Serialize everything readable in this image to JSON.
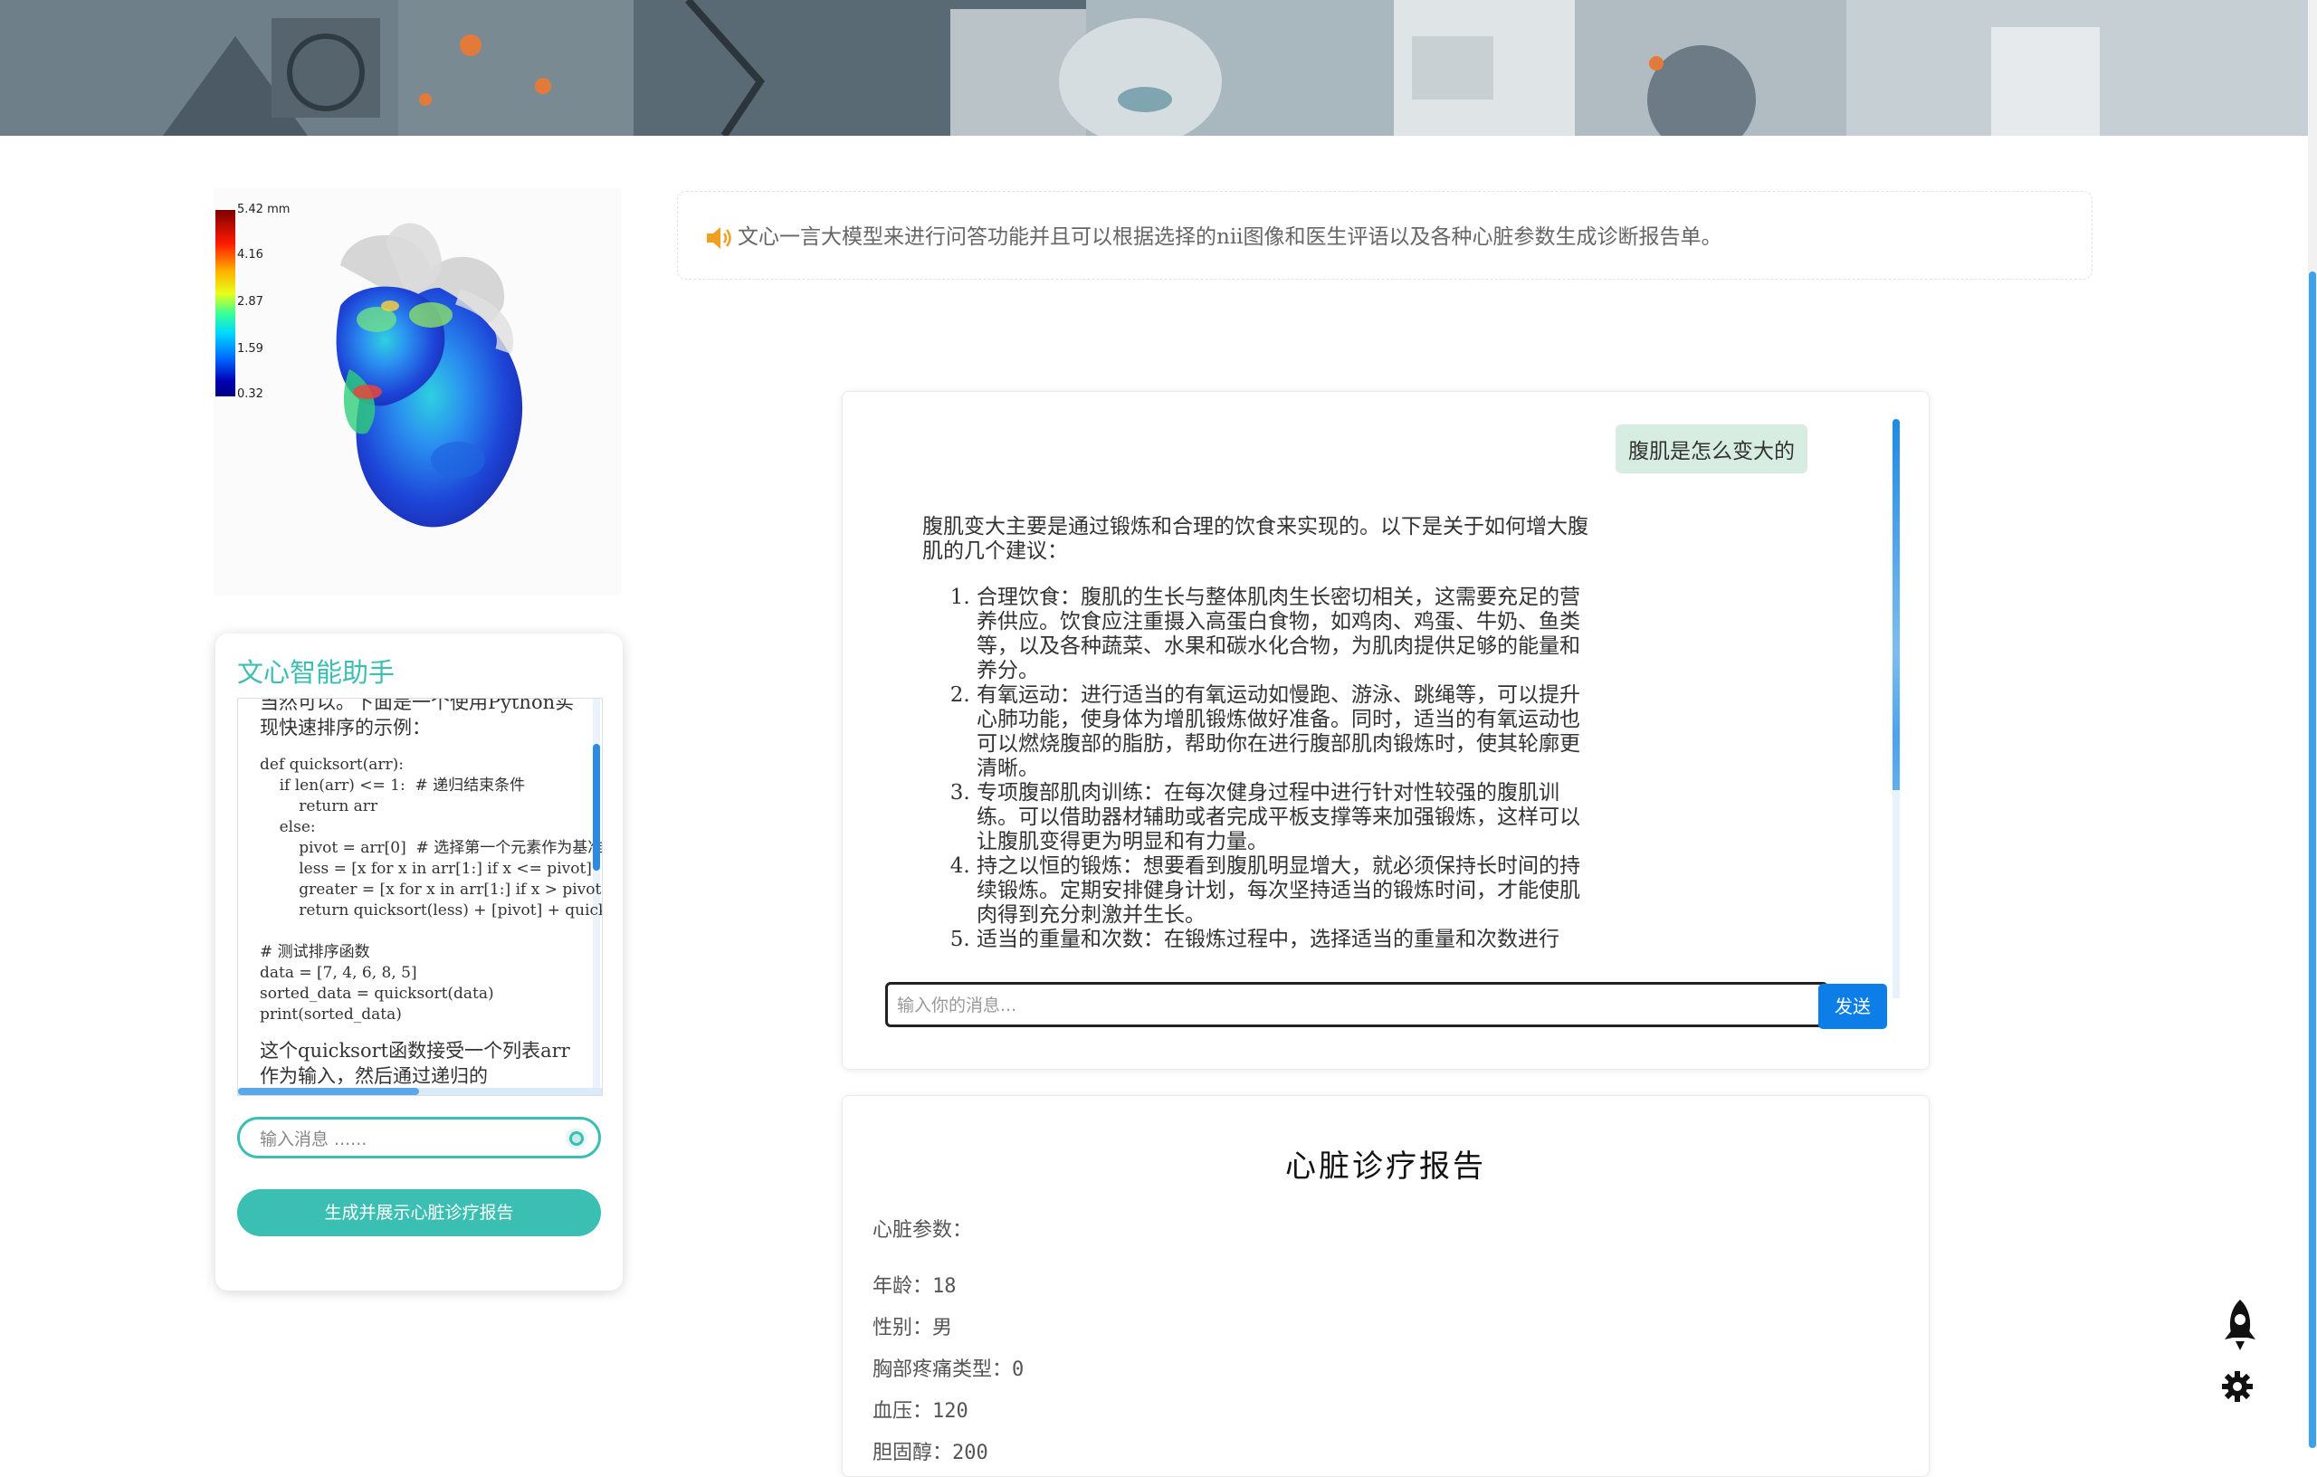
{
  "banner": {
    "alt": "anime illustration banner"
  },
  "heart_viewer": {
    "colorbar_labels": [
      "5.42 mm",
      "4.16",
      "2.87",
      "1.59",
      "0.32"
    ],
    "colors": [
      "#7f0000",
      "#ff1a00",
      "#ffb300",
      "#33ff99",
      "#0066ff",
      "#000080"
    ]
  },
  "assistant": {
    "title": "文心智能助手",
    "message_intro": "当然可以。下面是一个使用Python实现快速排序的示例：",
    "code": "def quicksort(arr):\n    if len(arr) <= 1:  # 递归结束条件\n        return arr\n    else:\n        pivot = arr[0]  # 选择第一个元素作为基准\n        less = [x for x in arr[1:] if x <= pivot]\n        greater = [x for x in arr[1:] if x > pivot]\n        return quicksort(less) + [pivot] + quicksort(greater)\n\n# 测试排序函数\ndata = [7, 4, 6, 8, 5]\nsorted_data = quicksort(data)\nprint(sorted_data)",
    "message_tail": "这个quicksort函数接受一个列表arr作为输入，然后通过递归的",
    "input_placeholder": "输入消息 ......",
    "report_button": "生成并展示心脏诊疗报告",
    "accent": "#3cbfb3"
  },
  "notice": {
    "text": "文心一言大模型来进行问答功能并且可以根据选择的nii图像和医生评语以及各种心脏参数生成诊断报告单。"
  },
  "chat": {
    "user_message": "腹肌是怎么变大的",
    "answer_intro": "腹肌变大主要是通过锻炼和合理的饮食来实现的。以下是关于如何增大腹肌的几个建议：",
    "answer_items": [
      "合理饮食：腹肌的生长与整体肌肉生长密切相关，这需要充足的营养供应。饮食应注重摄入高蛋白食物，如鸡肉、鸡蛋、牛奶、鱼类等，以及各种蔬菜、水果和碳水化合物，为肌肉提供足够的能量和养分。",
      "有氧运动：进行适当的有氧运动如慢跑、游泳、跳绳等，可以提升心肺功能，使身体为增肌锻炼做好准备。同时，适当的有氧运动也可以燃烧腹部的脂肪，帮助你在进行腹部肌肉锻炼时，使其轮廓更清晰。",
      "专项腹部肌肉训练：在每次健身过程中进行针对性较强的腹肌训练。可以借助器材辅助或者完成平板支撑等来加强锻炼，这样可以让腹肌变得更为明显和有力量。",
      "持之以恒的锻炼：想要看到腹肌明显增大，就必须保持长时间的持续锻炼。定期安排健身计划，每次坚持适当的锻炼时间，才能使肌肉得到充分刺激并生长。",
      "适当的重量和次数：在锻炼过程中，选择适当的重量和次数进行"
    ],
    "input_placeholder": "输入你的消息...",
    "send_label": "发送",
    "send_color": "#0d7ee8"
  },
  "report": {
    "title": "心脏诊疗报告",
    "params_label": "心脏参数：",
    "rows": [
      "年龄：18",
      "性别：男",
      "胸部疼痛类型：0",
      "血压：120",
      "胆固醇：200"
    ]
  },
  "floating": {
    "rocket_icon": "rocket-icon",
    "settings_icon": "gear-icon"
  }
}
